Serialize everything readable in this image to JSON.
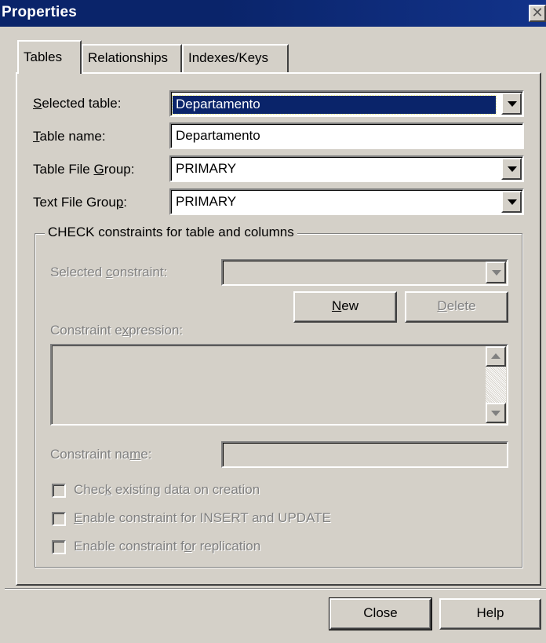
{
  "window": {
    "title": "Properties",
    "close_glyph": "✕"
  },
  "tabs": [
    {
      "label": "Tables",
      "active": true
    },
    {
      "label": "Relationships",
      "active": false
    },
    {
      "label": "Indexes/Keys",
      "active": false
    }
  ],
  "table_section": {
    "selected_table_label_pre": "",
    "selected_table_label_key": "S",
    "selected_table_label_post": "elected table:",
    "selected_table_value": "Departamento",
    "table_name_label_key": "T",
    "table_name_label_post": "able name:",
    "table_name_value": "Departamento",
    "table_file_group_label_pre": "Table File ",
    "table_file_group_label_key": "G",
    "table_file_group_label_post": "roup:",
    "table_file_group_value": "PRIMARY",
    "text_file_group_label_pre": "Text File Grou",
    "text_file_group_label_key": "p",
    "text_file_group_label_post": ":",
    "text_file_group_value": "PRIMARY"
  },
  "check_constraints": {
    "group_title": "CHECK constraints for table and columns",
    "selected_constraint_label_pre": "Selected ",
    "selected_constraint_label_key": "c",
    "selected_constraint_label_post": "onstraint:",
    "selected_constraint_value": "",
    "new_button_key": "N",
    "new_button_post": "ew",
    "delete_button_key": "D",
    "delete_button_post": "elete",
    "constraint_expression_label_pre": "Constraint e",
    "constraint_expression_label_key": "x",
    "constraint_expression_label_post": "pression:",
    "constraint_expression_value": "",
    "constraint_name_label_pre": "Constraint na",
    "constraint_name_label_key": "m",
    "constraint_name_label_post": "e:",
    "constraint_name_value": "",
    "options": [
      {
        "pre": "Chec",
        "key": "k",
        "post": " existing data on creation",
        "checked": false
      },
      {
        "pre": "",
        "key": "E",
        "post": "nable constraint for INSERT and UPDATE",
        "checked": false
      },
      {
        "pre": "Enable constraint f",
        "key": "o",
        "post": "r replication",
        "checked": false
      }
    ]
  },
  "footer": {
    "close_label": "Close",
    "help_label": "Help"
  },
  "colors": {
    "titlebar": "#0a246a",
    "face": "#d4d0c8",
    "selection": "#0a246a",
    "disabled_text": "#808080"
  }
}
